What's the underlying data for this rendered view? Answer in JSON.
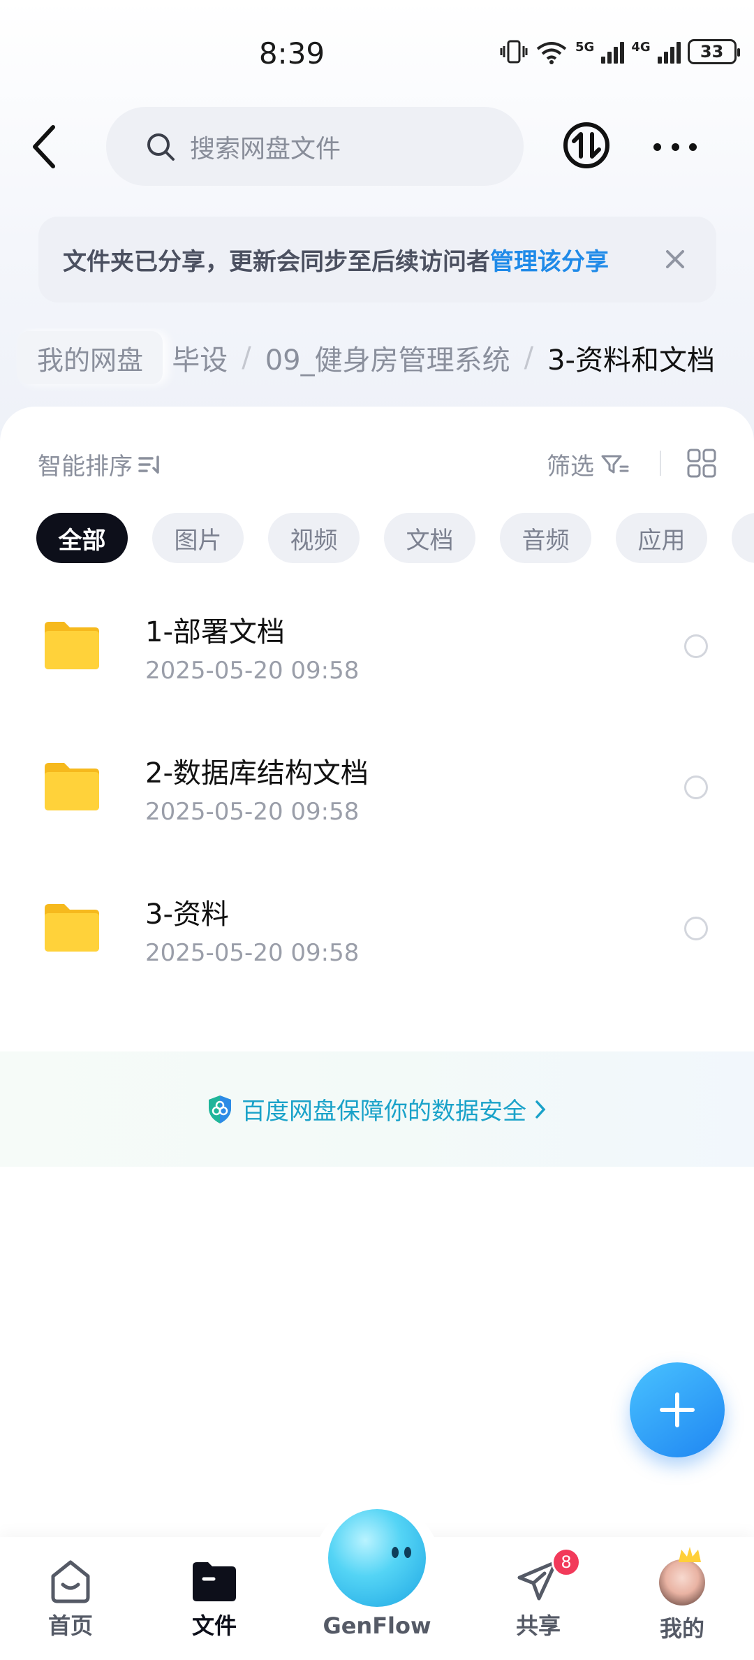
{
  "status_bar": {
    "time": "8:39",
    "network_1": "5G",
    "network_2": "4G",
    "battery": "33"
  },
  "header": {
    "search_placeholder": "搜索网盘文件"
  },
  "notice": {
    "text": "文件夹已分享，更新会同步至后续访问者",
    "link": "管理该分享"
  },
  "breadcrumb": {
    "root": "我的网盘",
    "items": [
      "毕设",
      "09_健身房管理系统"
    ],
    "current": "3-资料和文档",
    "separator": "/"
  },
  "toolbar": {
    "sort_label": "智能排序",
    "filter_label": "筛选"
  },
  "chips": [
    "全部",
    "图片",
    "视频",
    "文档",
    "音频",
    "应用"
  ],
  "files": [
    {
      "name": "1-部署文档",
      "date": "2025-05-20  09:58",
      "type": "folder"
    },
    {
      "name": "2-数据库结构文档",
      "date": "2025-05-20  09:58",
      "type": "folder"
    },
    {
      "name": "3-资料",
      "date": "2025-05-20  09:58",
      "type": "folder"
    }
  ],
  "safety": {
    "text": "百度网盘保障你的数据安全"
  },
  "nav": {
    "home": "首页",
    "files": "文件",
    "genflow": "GenFlow",
    "share": "共享",
    "share_badge": "8",
    "me": "我的"
  },
  "colors": {
    "accent": "#1f8ae8",
    "folder": "#ffd23a",
    "fab": "#2a95f5",
    "badge": "#f23a5a"
  }
}
